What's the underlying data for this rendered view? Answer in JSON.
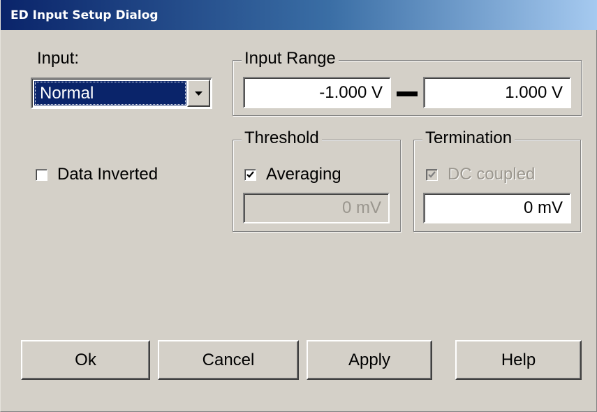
{
  "window": {
    "title": "ED Input Setup Dialog"
  },
  "input": {
    "label": "Input:",
    "selected": "Normal",
    "dropdown_icon": "chevron-down-icon"
  },
  "input_range": {
    "title": "Input Range",
    "min": "-1.000 V",
    "max": "1.000 V"
  },
  "data_inverted": {
    "label": "Data Inverted",
    "checked": false
  },
  "threshold": {
    "title": "Threshold",
    "averaging_label": "Averaging",
    "averaging_checked": true,
    "value": "0 mV",
    "value_disabled": true
  },
  "termination": {
    "title": "Termination",
    "dc_coupled_label": "DC coupled",
    "dc_coupled_checked": true,
    "dc_coupled_disabled": true,
    "value": "0 mV"
  },
  "buttons": {
    "ok": "Ok",
    "cancel": "Cancel",
    "apply": "Apply",
    "help": "Help"
  }
}
